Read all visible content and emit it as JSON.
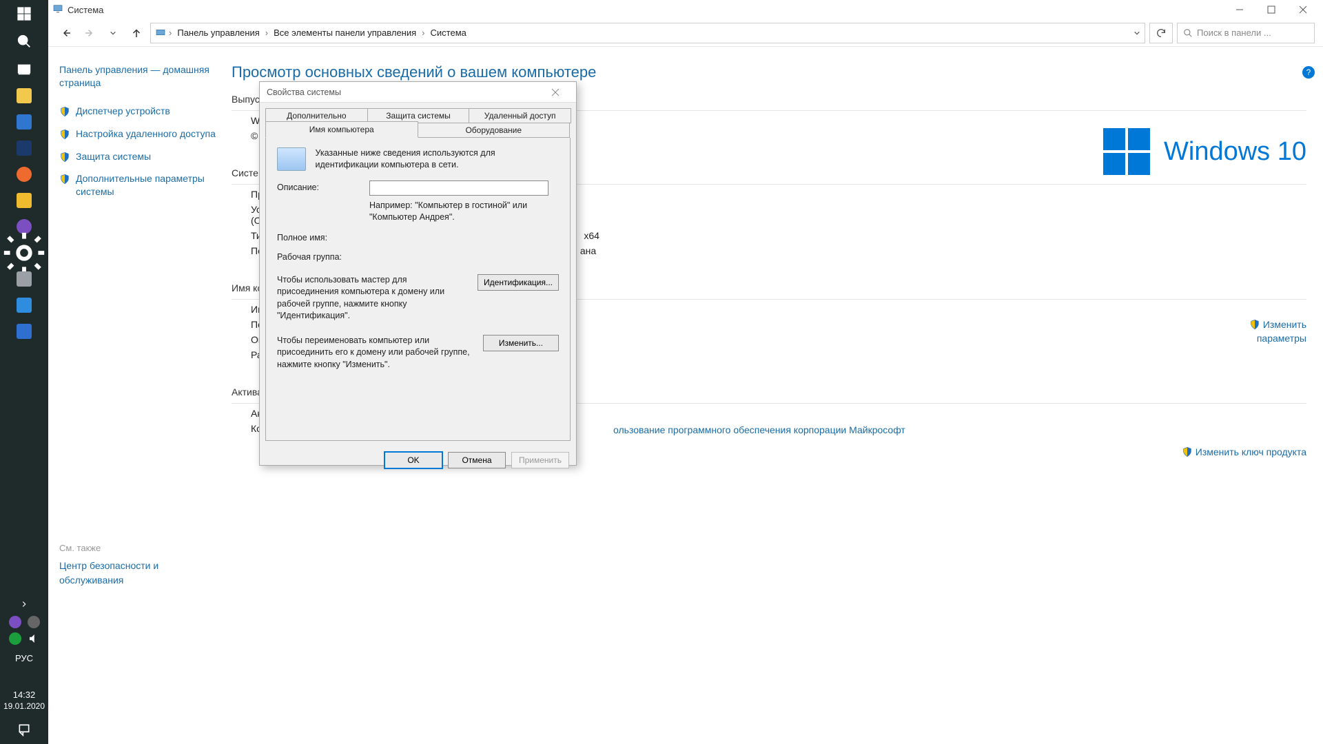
{
  "taskbar": {
    "lang": "РУС",
    "time": "14:32",
    "date": "19.01.2020",
    "icons": [
      {
        "name": "start",
        "color": "#ffffff"
      },
      {
        "name": "search",
        "color": "#ffffff"
      },
      {
        "name": "taskview",
        "color": "#ffffff"
      },
      {
        "name": "explorer",
        "color": "#f2c94c"
      },
      {
        "name": "remote",
        "color": "#2f76d0"
      },
      {
        "name": "disk",
        "color": "#1b3a6b"
      },
      {
        "name": "firefox",
        "color": "#ef6a2f"
      },
      {
        "name": "media",
        "color": "#f0bc2f"
      },
      {
        "name": "viber",
        "color": "#7b4fc2"
      },
      {
        "name": "settings",
        "color": "#ffffff"
      },
      {
        "name": "devices",
        "color": "#9aa0a6"
      },
      {
        "name": "monitor",
        "color": "#2f8de0"
      },
      {
        "name": "app",
        "color": "#2f6fd0"
      }
    ],
    "tray": [
      {
        "name": "viber-tray",
        "color": "#7b4fc2"
      },
      {
        "name": "cloud-tray",
        "color": "#666"
      },
      {
        "name": "torrent-tray",
        "color": "#1a9f3c"
      },
      {
        "name": "sound-tray",
        "color": "#ffffff"
      }
    ]
  },
  "titlebar": {
    "title": "Система"
  },
  "breadcrumb": {
    "parts": [
      "Панель управления",
      "Все элементы панели управления",
      "Система"
    ]
  },
  "search": {
    "placeholder": "Поиск в панели ..."
  },
  "sidebar": {
    "home": "Панель управления — домашняя страница",
    "tasks": [
      "Диспетчер устройств",
      "Настройка удаленного доступа",
      "Защита системы",
      "Дополнительные параметры системы"
    ],
    "see_also_header": "См. также",
    "see_also_link": "Центр безопасности и обслуживания"
  },
  "main": {
    "heading": "Просмотр основных сведений о вашем компьютере",
    "section_release": "Выпуск",
    "section_system": "Систем",
    "section_name": "Имя ко",
    "section_activation": "Актива",
    "windows_brand": "Windows 10",
    "licence_link": "ользование программного обеспечения корпорации Майкрософт",
    "change_settings": {
      "line1": "Изменить",
      "line2": "параметры"
    },
    "change_key": "Изменить ключ продукта",
    "rows": {
      "arch_tail": "x64",
      "touch_tail": "ана"
    }
  },
  "dialog": {
    "title": "Свойства системы",
    "tabs_top": [
      "Дополнительно",
      "Защита системы",
      "Удаленный доступ"
    ],
    "tabs_bottom": [
      "Имя компьютера",
      "Оборудование"
    ],
    "active_tab": "Имя компьютера",
    "intro": "Указанные ниже сведения используются для идентификации компьютера в сети.",
    "desc_label": "Описание:",
    "desc_value": "",
    "desc_hint": "Например: \"Компьютер в гостиной\" или \"Компьютер Андрея\".",
    "full_name_label": "Полное имя:",
    "workgroup_label": "Рабочая группа:",
    "para1": "Чтобы использовать мастер для присоединения компьютера к домену или рабочей группе, нажмите кнопку \"Идентификация\".",
    "btn_identify": "Идентификация...",
    "para2": "Чтобы переименовать компьютер или присоединить его к домену или рабочей группе, нажмите кнопку \"Изменить\".",
    "btn_change": "Изменить...",
    "btn_ok": "OK",
    "btn_cancel": "Отмена",
    "btn_apply": "Применить"
  }
}
